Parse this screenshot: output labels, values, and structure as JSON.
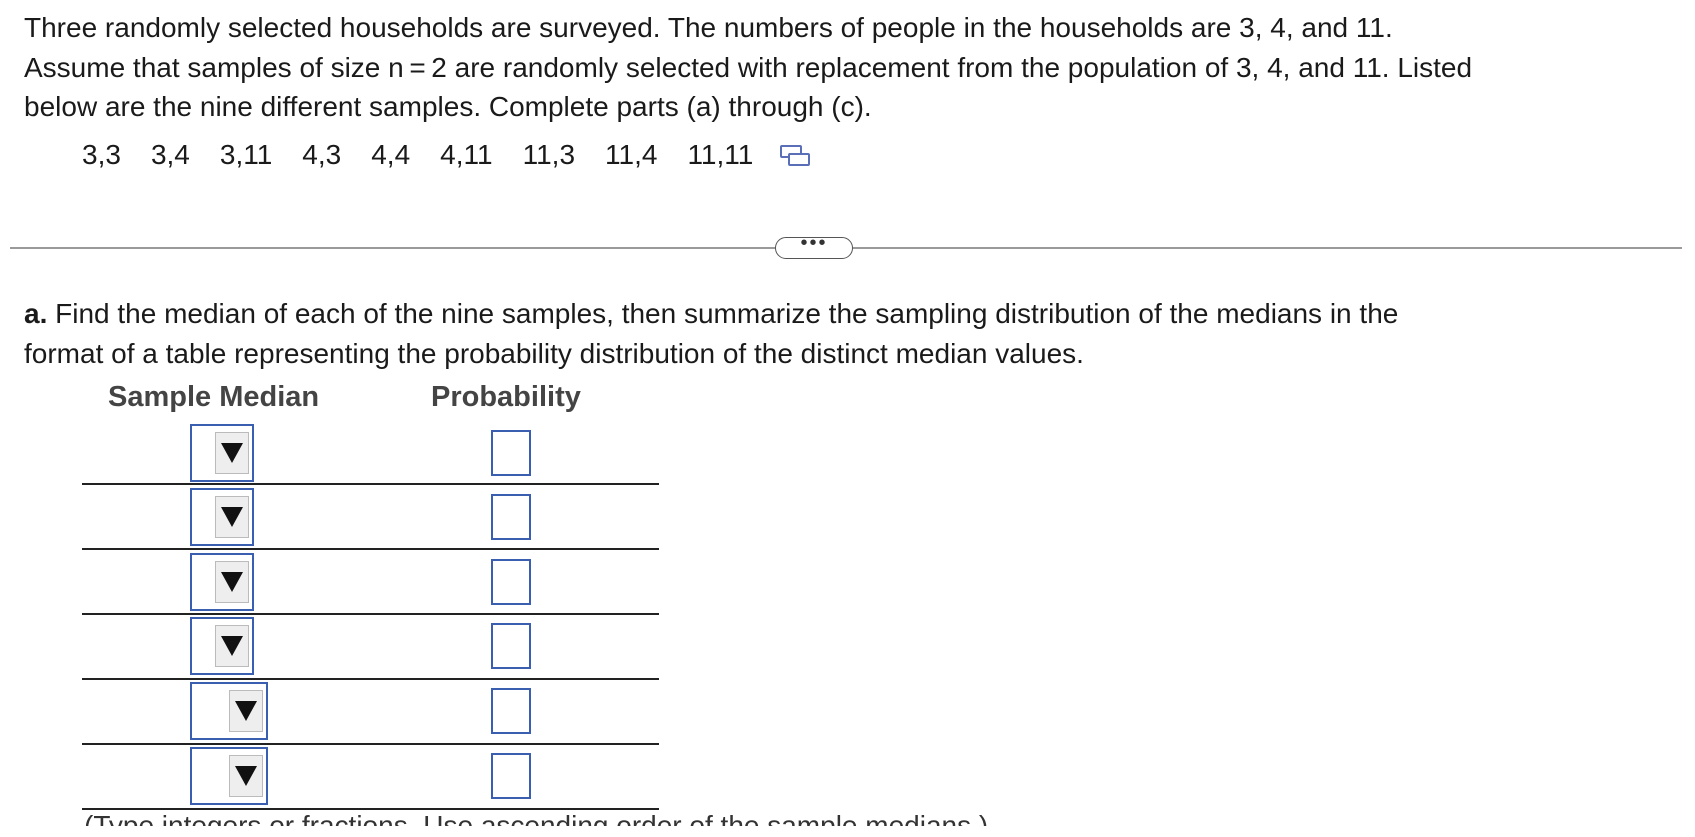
{
  "problem": {
    "line1": "Three randomly selected households are surveyed. The numbers of people in the households are 3, 4, and 11.",
    "line2": "Assume that samples of size n = 2 are randomly selected with replacement from the population of 3, 4, and 11. Listed",
    "line3": "below are the nine different samples. Complete parts (a) through (c)."
  },
  "samples": [
    "3,3",
    "3,4",
    "3,11",
    "4,3",
    "4,4",
    "4,11",
    "11,3",
    "11,4",
    "11,11"
  ],
  "copy_icon": "copy-data-icon",
  "more_button": "•••",
  "part_a": {
    "label": "a.",
    "line1": " Find the median of each of the nine samples, then summarize the sampling distribution of the medians in the",
    "line2": "format of a table representing the probability distribution of the distinct median values."
  },
  "table": {
    "col_median": "Sample Median",
    "col_probability": "Probability",
    "rows": [
      {
        "median": "",
        "probability": ""
      },
      {
        "median": "",
        "probability": ""
      },
      {
        "median": "",
        "probability": ""
      },
      {
        "median": "",
        "probability": ""
      },
      {
        "median": "",
        "probability": ""
      },
      {
        "median": "",
        "probability": ""
      }
    ]
  },
  "clipped_note": "(Type integers or fractions. Use ascending order of the sample medians.)",
  "colors": {
    "accent_border": "#3a5fb0",
    "divider": "#9a9a9a"
  }
}
